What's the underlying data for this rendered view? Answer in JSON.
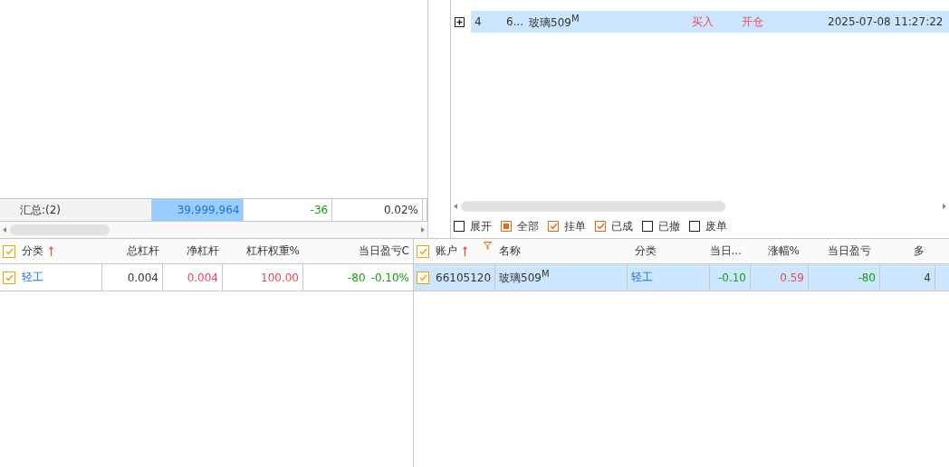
{
  "orders": {
    "rows": [
      {
        "no": "4",
        "account": "6...",
        "name": "玻璃509$^{M}$",
        "side": "买入",
        "action": "开仓",
        "time": "2025-07-08 11:27:22",
        "selected": true
      }
    ],
    "filters": [
      {
        "label": "展开",
        "checked": false,
        "indeterminate": false
      },
      {
        "label": "全部",
        "checked": false,
        "indeterminate": true
      },
      {
        "label": "挂单",
        "checked": true,
        "indeterminate": false
      },
      {
        "label": "已成",
        "checked": true,
        "indeterminate": false
      },
      {
        "label": "已撤",
        "checked": false,
        "indeterminate": false
      },
      {
        "label": "废单",
        "checked": false,
        "indeterminate": false
      }
    ]
  },
  "summary": {
    "label": "汇总:(2)",
    "cells": [
      {
        "text": "39,999,964",
        "selected": true,
        "color": "#1a73d9"
      },
      {
        "text": "-36",
        "selected": false,
        "color": "#13a10e"
      },
      {
        "text": "0.02%",
        "selected": false,
        "color": "#333333"
      }
    ]
  },
  "category_table": {
    "all_checked": true,
    "columns": [
      "分类",
      "总杠杆",
      "净杠杆",
      "杠杆权重%",
      "当日盈亏C"
    ],
    "rows": [
      {
        "checked": true,
        "selected": false,
        "category": "轻工",
        "total": "0.004",
        "net": "0.004",
        "weight": "100.00",
        "pnl": "-80",
        "pnl_pct": "-0.10%"
      }
    ]
  },
  "position_table": {
    "all_checked": true,
    "columns": [
      "账户",
      "名称",
      "分类",
      "当日...",
      "涨幅%",
      "当日盈亏",
      "多"
    ],
    "rows": [
      {
        "checked": true,
        "selected": true,
        "account": "66105120",
        "name": "玻璃509$^{M}$",
        "category": "轻工",
        "day": "-0.10",
        "change": "0.59",
        "pnl": "-80",
        "long": "4"
      }
    ]
  }
}
